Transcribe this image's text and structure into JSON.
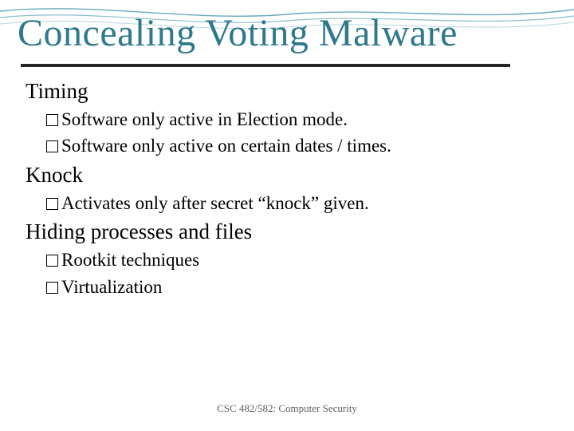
{
  "title": "Concealing Voting Malware",
  "sections": [
    {
      "heading": "Timing",
      "items": [
        "Software only active in Election mode.",
        "Software only active on certain dates / times."
      ]
    },
    {
      "heading": "Knock",
      "items": [
        "Activates only after secret “knock” given."
      ]
    },
    {
      "heading": "Hiding processes and files",
      "items": [
        "Rootkit techniques",
        "Virtualization"
      ]
    }
  ],
  "footer": "CSC 482/582: Computer Security"
}
